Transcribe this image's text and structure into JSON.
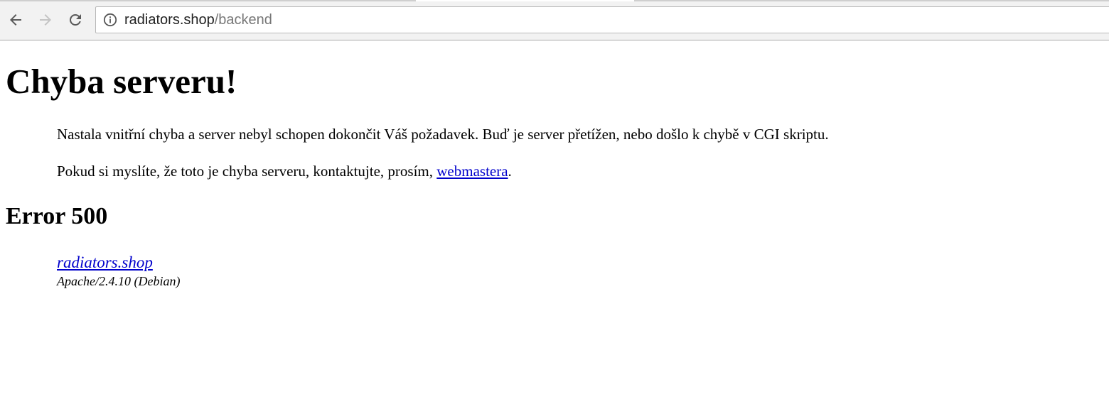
{
  "browser": {
    "back_icon": "arrow-left-icon",
    "forward_icon": "arrow-right-icon",
    "reload_icon": "reload-icon",
    "info_icon": "info-circle-icon",
    "url_host": "radiators.shop",
    "url_path": "/backend"
  },
  "page": {
    "title": "Chyba serveru!",
    "paragraph1": "Nastala vnitřní chyba a server nebyl schopen dokončit Váš požadavek. Buď je server přetížen, nebo došlo k chybě v CGI skriptu.",
    "paragraph2_prefix": "Pokud si myslíte, že toto je chyba serveru, kontaktujte, prosím, ",
    "paragraph2_link": "webmastera",
    "paragraph2_suffix": ".",
    "error_heading": "Error 500",
    "footer_site_link": "radiators.shop",
    "footer_server": "Apache/2.4.10 (Debian)"
  },
  "colors": {
    "link": "#0000cc",
    "toolbar_bg": "#f2f2f2",
    "url_path": "#777777"
  }
}
